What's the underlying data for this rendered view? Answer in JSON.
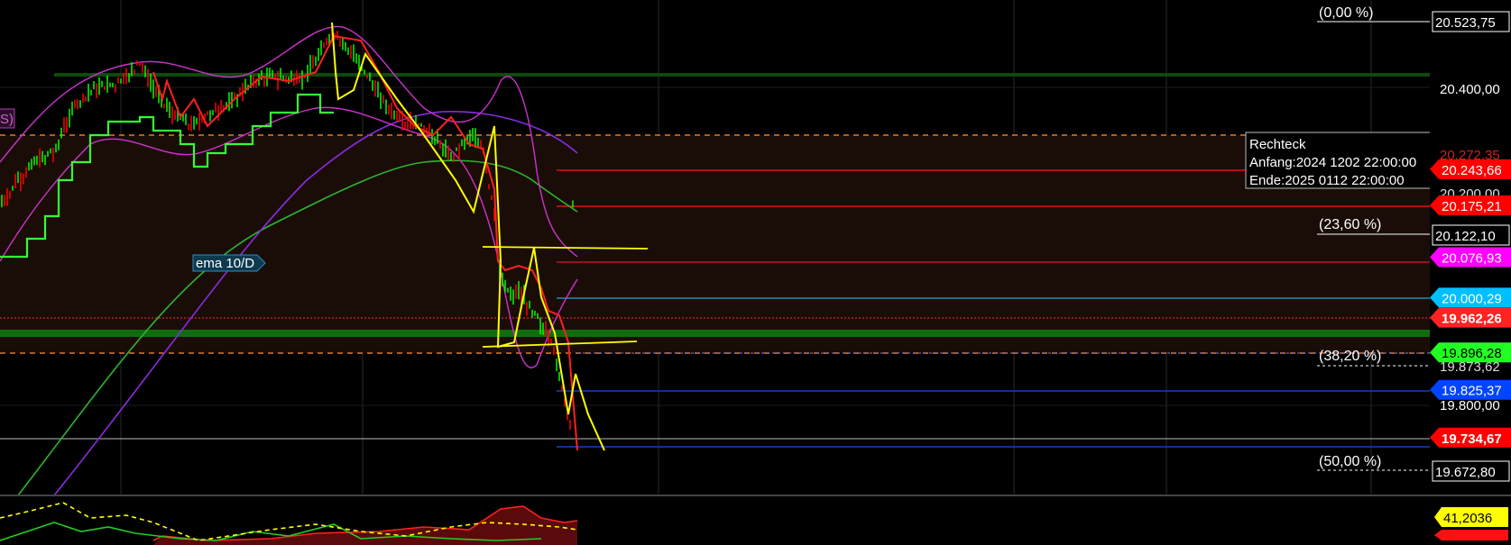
{
  "chart_data": {
    "type": "line",
    "title": "",
    "xlabel": "",
    "ylabel": "",
    "ylim": [
      19600,
      20560
    ],
    "grid": true,
    "y_ticks": [
      {
        "value": 20400.0,
        "label": "20.400,00"
      },
      {
        "value": 19800.0,
        "label": "19.800,00"
      }
    ],
    "fibonacci": [
      {
        "label": "(0,00 %)",
        "value": 20523.75,
        "price_label": "20.523,75"
      },
      {
        "label": "(23,60 %)",
        "value": 20122.1,
        "price_label": "20.122,10"
      },
      {
        "label": "(38,20 %)",
        "value": 19873.62,
        "price_label": "19.873,62"
      },
      {
        "label": "(50,00 %)",
        "value": 19672.8,
        "price_label": "19.672,80"
      }
    ],
    "horizontal_levels": [
      {
        "value": 20243.66,
        "label": "20.243,66",
        "color": "#ff0000"
      },
      {
        "value": 20175.21,
        "label": "20.175,21",
        "color": "#ff0000"
      },
      {
        "value": 20076.93,
        "label": "20.076,93",
        "color": "#ff00ff"
      },
      {
        "value": 20000.29,
        "label": "20.000,29",
        "color": "#00bfff"
      },
      {
        "value": 19962.26,
        "label": "19.962,26",
        "color": "#ff2222"
      },
      {
        "value": 19896.28,
        "label": "19.896,28",
        "color": "#22ff22"
      },
      {
        "value": 19825.37,
        "label": "19.825,37",
        "color": "#0044ff"
      },
      {
        "value": 19734.67,
        "label": "19.734,67",
        "color": "#ff0000"
      }
    ],
    "partial_labels": [
      {
        "value": 20272.35,
        "label": "20.272,35"
      },
      {
        "value": 20200.0,
        "label": "20.200,00"
      }
    ],
    "annotations": [
      {
        "text": "ema 10/D"
      },
      {
        "text": "S)"
      }
    ],
    "rectangle_info": {
      "title": "Rechteck",
      "start": "Anfang:2024 1202 22:00:00",
      "end": "Ende:2025 0112 22:00:00"
    },
    "oscillator": {
      "value": 41.2036,
      "label": "41,2036",
      "colors": [
        "#ffff00",
        "#ff0000",
        "#00ff00"
      ]
    },
    "series": [
      {
        "values": [
          19990,
          20120,
          20250,
          20330,
          20300,
          20260,
          20330,
          20420,
          20490,
          20420,
          20330,
          20230,
          20180,
          20090,
          19990,
          19920,
          19850,
          19760
        ]
      },
      {
        "values": [
          19950,
          20050,
          20150,
          20250,
          20300,
          20300,
          20350,
          20450,
          20420,
          20340,
          20260,
          20150,
          20120,
          19980,
          19900,
          19870,
          19820,
          19720
        ]
      }
    ],
    "colors": {
      "background": "#000000",
      "grid": "#333333",
      "candle_up": "#00ff00",
      "candle_down": "#ff0000",
      "bollinger": "#cc33cc",
      "ma_green": "#2db52d",
      "ma_purple": "#8a2be2",
      "drawing": "#ffff00",
      "fib_line": "#ffffff",
      "zone": "#1a0d08"
    }
  }
}
